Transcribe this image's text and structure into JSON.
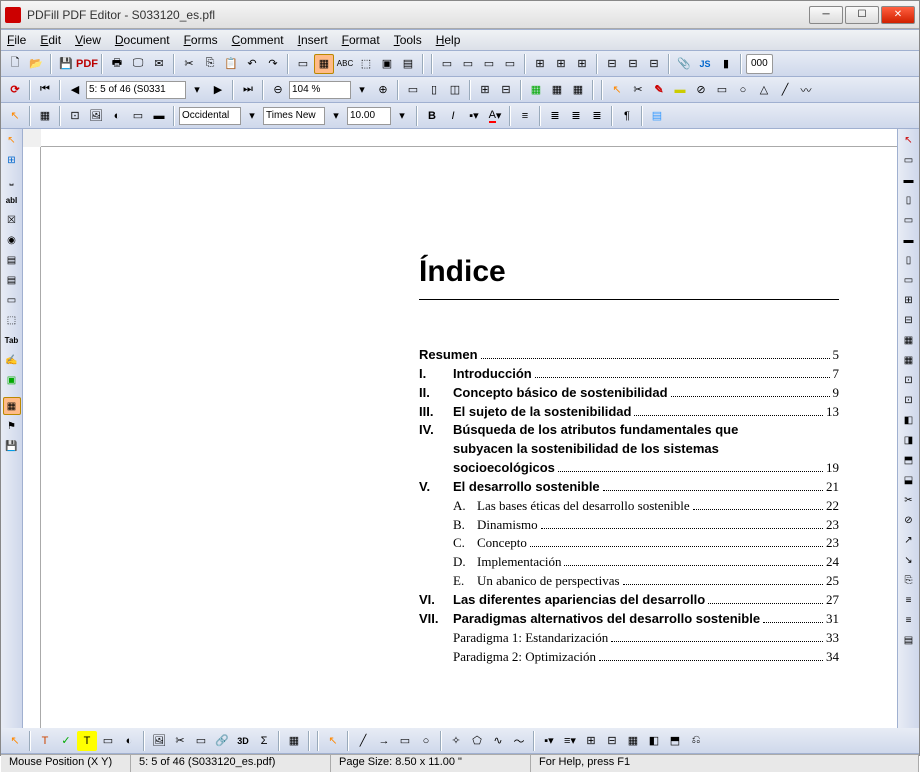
{
  "app": {
    "title": "PDFill PDF Editor - S033120_es.pfl"
  },
  "menus": [
    "File",
    "Edit",
    "View",
    "Document",
    "Forms",
    "Comment",
    "Insert",
    "Format",
    "Tools",
    "Help"
  ],
  "nav": {
    "page_display": "5: 5 of 46 (S0331",
    "zoom": "104 %"
  },
  "format": {
    "font_family": "Times New",
    "font_size": "10.00",
    "encoding": "Occidental"
  },
  "status": {
    "mouse_label": "Mouse Position (X Y)",
    "page_info": "5: 5 of 46 (S033120_es.pdf)",
    "page_size": "Page Size: 8.50 x 11.00 \"",
    "help": "For Help, press F1"
  },
  "document": {
    "heading": "Índice",
    "toc": [
      {
        "num": "",
        "title": "Resumen",
        "page": "5",
        "bold": true
      },
      {
        "num": "I.",
        "title": "Introducción",
        "page": "7",
        "bold": true
      },
      {
        "num": "II.",
        "title": "Concepto básico de sostenibilidad",
        "page": "9",
        "bold": true
      },
      {
        "num": "III.",
        "title": "El sujeto de la sostenibilidad",
        "page": "13",
        "bold": true
      },
      {
        "num": "IV.",
        "title": "Búsqueda de los atributos fundamentales que subyacen la sostenibilidad de los sistemas socioecológicos",
        "page": "19",
        "bold": true,
        "wrap": true
      },
      {
        "num": "V.",
        "title": "El desarrollo sostenible",
        "page": "21",
        "bold": true
      },
      {
        "num": "A.",
        "title": "Las bases éticas del desarrollo sostenible",
        "page": "22",
        "sub": true
      },
      {
        "num": "B.",
        "title": "Dinamismo",
        "page": "23",
        "sub": true
      },
      {
        "num": "C.",
        "title": "Concepto",
        "page": "23",
        "sub": true
      },
      {
        "num": "D.",
        "title": "Implementación",
        "page": "24",
        "sub": true
      },
      {
        "num": "E.",
        "title": "Un abanico de perspectivas",
        "page": "25",
        "sub": true
      },
      {
        "num": "VI.",
        "title": "Las diferentes apariencias del desarrollo",
        "page": "27",
        "bold": true
      },
      {
        "num": "VII.",
        "title": "Paradigmas alternativos del desarrollo sostenible",
        "page": "31",
        "bold": true
      },
      {
        "num": "",
        "title": "Paradigma 1: Estandarización",
        "page": "33",
        "sub2": true
      },
      {
        "num": "",
        "title": "Paradigma 2: Optimización",
        "page": "34",
        "sub2": true
      }
    ]
  },
  "labels": {
    "tab": "Tab",
    "abl": "abI",
    "pdf": "PDF",
    "js": "JS",
    "3d": "3D",
    "sigma": "Σ",
    "zero": "000"
  }
}
